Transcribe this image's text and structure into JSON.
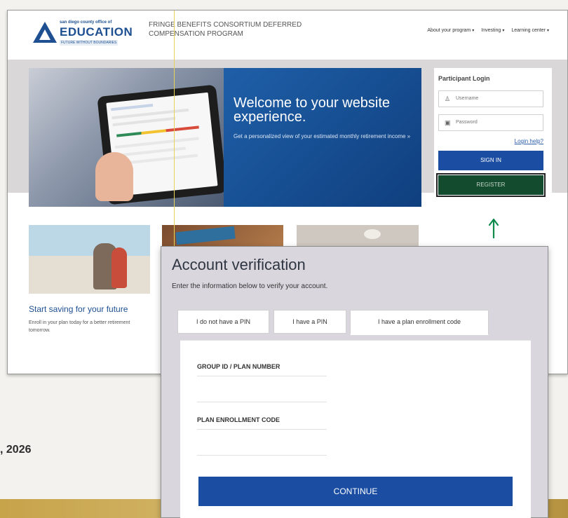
{
  "header": {
    "logo_small": "san diego county office of",
    "logo_main": "EDUCATION",
    "logo_tag": "FUTURE WITHOUT BOUNDARIES",
    "program_title": "FRINGE BENEFITS CONSORTIUM DEFERRED COMPENSATION PROGRAM",
    "nav": [
      "About your program",
      "Investing",
      "Learning center"
    ]
  },
  "hero": {
    "title": "Welcome to your website experience.",
    "subtitle": "Get a personalized view of your estimated monthly retirement income »"
  },
  "login": {
    "title": "Participant Login",
    "username_placeholder": "Username",
    "password_placeholder": "Password",
    "help_link": "Login help?",
    "signin_label": "SIGN IN",
    "register_label": "REGISTER"
  },
  "promo": {
    "title": "Start saving for your future",
    "body": "Enroll in your plan today for a better retirement tomorrow."
  },
  "page_fragment": {
    "date": ", 2026"
  },
  "verification": {
    "title": "Account verification",
    "subtitle": "Enter the information below to verify your account.",
    "tabs": [
      "I do not have a PIN",
      "I have a PIN",
      "I have a plan enrollment code"
    ],
    "active_tab": "I have a plan enrollment code",
    "fields": {
      "group_label": "GROUP ID / PLAN NUMBER",
      "code_label": "PLAN ENROLLMENT CODE"
    },
    "continue_label": "CONTINUE"
  },
  "colors": {
    "brand_blue": "#1d4f91",
    "button_blue": "#1b4ea3",
    "register_green": "#124b2e",
    "arrow_green": "#0f8a4b"
  }
}
